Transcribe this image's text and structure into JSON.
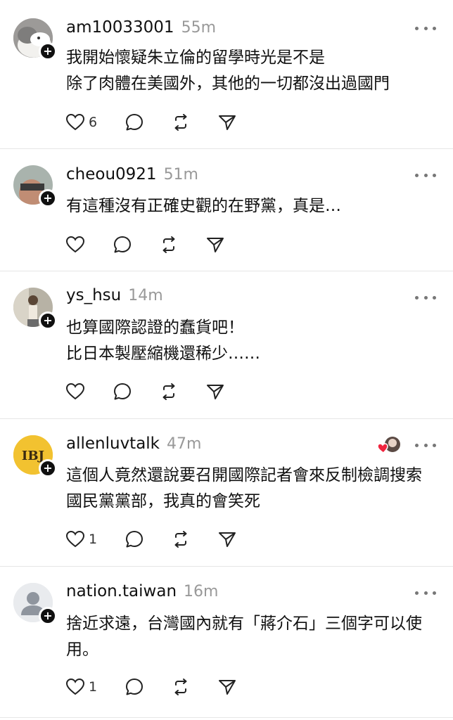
{
  "posts": [
    {
      "username": "am10033001",
      "time": "55m",
      "text": "我開始懷疑朱立倫的留學時光是不是\n除了肉體在美國外，其他的一切都沒出過國門",
      "likes": "6"
    },
    {
      "username": "cheou0921",
      "time": "51m",
      "text": "有這種沒有正確史觀的在野黨，真是…",
      "likes": ""
    },
    {
      "username": "ys_hsu",
      "time": "14m",
      "text": "也算國際認證的蠢貨吧！\n比日本製壓縮機還稀少……",
      "likes": ""
    },
    {
      "username": "allenluvtalk",
      "time": "47m",
      "text": "這個人竟然還說要召開國際記者會來反制檢調搜索\n國民黨黨部，我真的會笑死",
      "likes": "1"
    },
    {
      "username": "nation.taiwan",
      "time": "16m",
      "text": "捨近求遠，台灣國內就有「蔣介石」三個字可以使\n用。",
      "likes": "1"
    }
  ],
  "avatar_text": {
    "allenluvtalk": "IBJ"
  },
  "icons": [
    "heart-icon",
    "comment-icon",
    "repost-icon",
    "share-icon",
    "more-icon",
    "follow-plus-icon"
  ],
  "colors": {
    "text": "#101010",
    "muted": "#999999",
    "divider": "#e6e6e6"
  }
}
